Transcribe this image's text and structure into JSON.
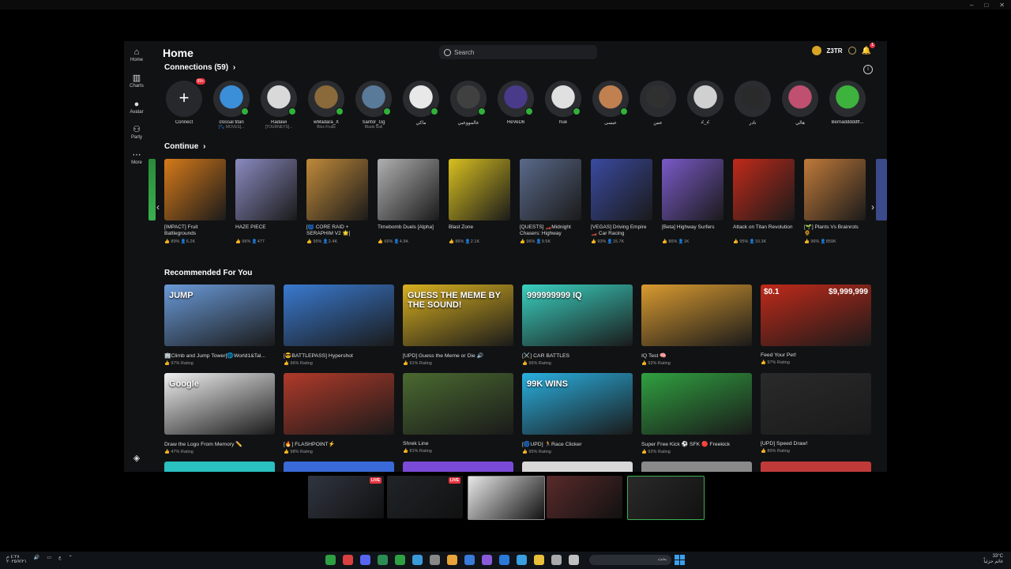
{
  "window": {
    "minimize": "–",
    "maximize": "□",
    "close": "✕"
  },
  "rail": [
    {
      "label": "Home",
      "icon": "home-icon",
      "glyph": "⌂"
    },
    {
      "label": "Charts",
      "icon": "charts-icon",
      "glyph": "▥"
    },
    {
      "label": "Avatar",
      "icon": "avatar-icon",
      "glyph": "●"
    },
    {
      "label": "Party",
      "icon": "party-icon",
      "glyph": "⚇"
    },
    {
      "label": "More",
      "icon": "more-icon",
      "glyph": "⋯"
    }
  ],
  "header": {
    "title": "Home",
    "search_placeholder": "Search",
    "username": "Z3TR",
    "bell_count": "1"
  },
  "connections": {
    "title": "Connections (59)",
    "chevron": "›",
    "connect_label": "Connect",
    "connect_badge": "99+",
    "items": [
      {
        "name": "clossal titan",
        "status": "[🐾 MOVES]...",
        "color": "#3b8fd9",
        "online": true
      },
      {
        "name": "Radawi",
        "status": "[TOURNEYS]...",
        "color": "#d9d9d9",
        "online": true
      },
      {
        "name": "wMadara_X",
        "status": "Blox Fruits",
        "color": "#8a6a3a",
        "online": true
      },
      {
        "name": "Sanfor_Gg",
        "status": "Blade Ball",
        "color": "#5a7a9a",
        "online": true
      },
      {
        "name": "ماكي",
        "status": "",
        "color": "#e8e8e8",
        "online": true
      },
      {
        "name": "عالمووعيي",
        "status": "",
        "color": "#404040",
        "online": true
      },
      {
        "name": "ReVeD6",
        "status": "",
        "color": "#4a3a8a",
        "online": true
      },
      {
        "name": "hue",
        "status": "",
        "color": "#e0e0e0",
        "online": true
      },
      {
        "name": "عيسى",
        "status": "",
        "color": "#c08050",
        "online": true
      },
      {
        "name": "عس",
        "status": "",
        "color": "#303030",
        "online": false
      },
      {
        "name": "Z_Z",
        "status": "",
        "color": "#d0d0d0",
        "online": false
      },
      {
        "name": "نادر",
        "status": "",
        "color": "#2a2a2a",
        "online": false
      },
      {
        "name": "هالي",
        "status": "",
        "color": "#c05070",
        "online": false
      },
      {
        "name": "Bernadddddff...",
        "status": "",
        "color": "#3db33d",
        "online": false
      }
    ]
  },
  "continue": {
    "title": "Continue",
    "chevron": "›",
    "prev": "‹",
    "next": "›",
    "items": [
      {
        "title": "[IMPACT] Fruit Battlegrounds",
        "rating": "89%",
        "players": "6.2K",
        "color": "#d67a1a"
      },
      {
        "title": "HAZE PIECE",
        "rating": "96%",
        "players": "477",
        "color": "#8a8ac0"
      },
      {
        "title": "[🌀 CORE RAID + SERAPHIM V2 🌟]",
        "rating": "95%",
        "players": "2.4K",
        "color": "#c08a3a"
      },
      {
        "title": "Timebomb Duels [Alpha]",
        "rating": "66%",
        "players": "4.9K",
        "color": "#b0b0b0"
      },
      {
        "title": "Blast Zone",
        "rating": "86%",
        "players": "2.1K",
        "color": "#d8c020"
      },
      {
        "title": "[QUESTS] 🏎️Midnight Chasers: Highway",
        "rating": "96%",
        "players": "9.5K",
        "color": "#5a6a8a"
      },
      {
        "title": "[VEGAS] Driving Empire🏎️ Car Racing",
        "rating": "93%",
        "players": "15.7K",
        "color": "#3a4aa0"
      },
      {
        "title": "[Beta] Highway Surfers",
        "rating": "86%",
        "players": "1K",
        "color": "#7a5ac8"
      },
      {
        "title": "Attack on Titan Revolution",
        "rating": "95%",
        "players": "10.3K",
        "color": "#c02a1a"
      },
      {
        "title": "[🌱] Plants Vs Brainrots 🌻",
        "rating": "96%",
        "players": "859K",
        "color": "#c07a3a"
      }
    ]
  },
  "recommended": {
    "title": "Recommended For You",
    "rows": [
      [
        {
          "title": "🏢Climb and Jump Tower[🌐World1&Tal...",
          "meta": "97% Rating",
          "color": "#6a9ad8"
        },
        {
          "title": "[😎BATTLEPASS] Hypershot",
          "meta": "96% Rating",
          "color": "#3a7ad0"
        },
        {
          "title": "[UPD] Guess the Meme or Die 🔊",
          "meta": "91% Rating",
          "color": "#d8b020"
        },
        {
          "title": "[⚔️] CAR BATTLES",
          "meta": "95% Rating",
          "color": "#3ad0c0"
        },
        {
          "title": "IQ Test 🧠",
          "meta": "92% Rating",
          "color": "#d89a30"
        },
        {
          "title": "Feed Your Pet!",
          "meta": "97% Rating",
          "color": "#c02a1a"
        }
      ],
      [
        {
          "title": "Draw the Logo From Memory ✏️",
          "meta": "47% Rating",
          "color": "#f0f0f0"
        },
        {
          "title": "[🔥] FLASHPOINT⚡",
          "meta": "98% Rating",
          "color": "#b03a2a"
        },
        {
          "title": "Shrek Line",
          "meta": "81% Rating",
          "color": "#4a6a30"
        },
        {
          "title": "[🌀UPD] 🏃Race Clicker",
          "meta": "95% Rating",
          "color": "#2ab0e0"
        },
        {
          "title": "Super Free Kick ⚽ SFK 🔴 Freekick",
          "meta": "92% Rating",
          "color": "#30a040"
        },
        {
          "title": "[UPD] Speed Draw!",
          "meta": "86% Rating",
          "color": "#2a2a2a"
        }
      ]
    ],
    "thumb_texts": {
      "r0c0": "JUMP",
      "r0c2": "GUESS THE MEME BY THE SOUND!",
      "r0c3": "999999999 IQ",
      "r0c5a": "$0.1",
      "r0c5b": "$9,999,999",
      "r1c0": "Google",
      "r1c3": "99K WINS"
    }
  },
  "stream": {
    "live_label": "LIVE",
    "cards": [
      "#303540",
      "#202428",
      "#e8e8e8",
      "#5a2a2a",
      "#2a2a2a"
    ]
  },
  "taskbar": {
    "time": "٤:٢٨ م",
    "date": "٢٠٢٥/٧/٢١",
    "weather": "33°C",
    "weather_desc": "غائم جزئياً",
    "search_label": "بحث",
    "lang": "ع",
    "app_colors": [
      "#2ea043",
      "#d94040",
      "#5865f2",
      "#2d8c54",
      "#2ea043",
      "#3a9ad9",
      "#888",
      "#e8a33a",
      "#3a7ad9",
      "#8a5ad8",
      "#2a7ad9",
      "#3aa0e0",
      "#e8c03a",
      "#aaa",
      "#c0c0c0"
    ]
  }
}
